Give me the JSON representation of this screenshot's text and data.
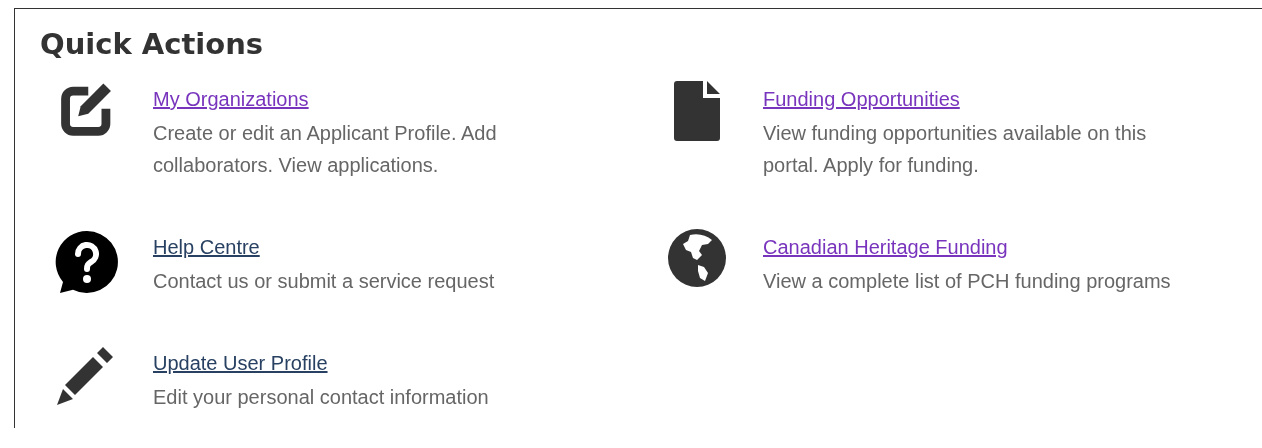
{
  "heading": "Quick Actions",
  "actions": [
    {
      "kind": "edit",
      "title": "My Organizations",
      "visited": true,
      "description": "Create or edit an Applicant Profile. Add collaborators. View applications."
    },
    {
      "kind": "file",
      "title": "Funding Opportunities",
      "visited": true,
      "description": "View funding opportunities available on this portal. Apply for funding."
    },
    {
      "kind": "help",
      "title": "Help Centre",
      "visited": false,
      "description": "Contact us or submit a service request"
    },
    {
      "kind": "globe",
      "title": "Canadian Heritage Funding",
      "visited": true,
      "description": "View a complete list of PCH funding programs"
    },
    {
      "kind": "pencil",
      "title": "Update User Profile",
      "visited": false,
      "description": "Edit your personal contact information"
    }
  ]
}
